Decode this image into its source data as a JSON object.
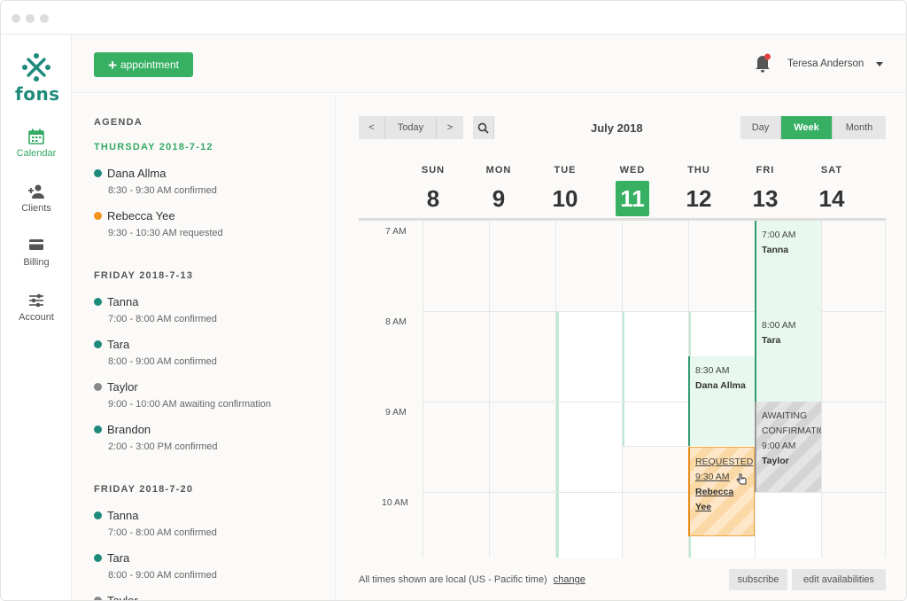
{
  "brand": {
    "name": "fons",
    "accent": "#37b063",
    "teal": "#1e8a7a"
  },
  "nav": [
    {
      "label": "Calendar",
      "icon": "calendar-icon",
      "active": true
    },
    {
      "label": "Clients",
      "icon": "clients-icon",
      "active": false
    },
    {
      "label": "Billing",
      "icon": "credit-card-icon",
      "active": false
    },
    {
      "label": "Account",
      "icon": "sliders-icon",
      "active": false
    }
  ],
  "topbar": {
    "add_label": "appointment",
    "user_name": "Teresa Anderson",
    "notification_dot_color": "#e04040"
  },
  "agenda": {
    "title": "AGENDA",
    "groups": [
      {
        "date": "THURSDAY 2018-7-12",
        "items": [
          {
            "name": "Dana Allma",
            "detail": "8:30 - 9:30 AM confirmed",
            "status_color": "#1e8a7a"
          },
          {
            "name": "Rebecca Yee",
            "detail": "9:30 - 10:30 AM requested",
            "status_color": "#f0941c"
          }
        ]
      },
      {
        "date": "FRIDAY 2018-7-13",
        "items": [
          {
            "name": "Tanna",
            "detail": "7:00 - 8:00 AM confirmed",
            "status_color": "#1e8a7a"
          },
          {
            "name": "Tara",
            "detail": "8:00 - 9:00 AM confirmed",
            "status_color": "#1e8a7a"
          },
          {
            "name": "Taylor",
            "detail": "9:00 - 10:00 AM awaiting confirmation",
            "status_color": "#888888"
          },
          {
            "name": "Brandon",
            "detail": "2:00 - 3:00 PM confirmed",
            "status_color": "#1e8a7a"
          }
        ]
      },
      {
        "date": "FRIDAY 2018-7-20",
        "items": [
          {
            "name": "Tanna",
            "detail": "7:00 - 8:00 AM confirmed",
            "status_color": "#1e8a7a"
          },
          {
            "name": "Tara",
            "detail": "8:00 - 9:00 AM confirmed",
            "status_color": "#1e8a7a"
          },
          {
            "name": "Taylor",
            "detail": "",
            "status_color": "#888888"
          }
        ]
      }
    ]
  },
  "calendar": {
    "prev_label": "<",
    "today_label": "Today",
    "next_label": ">",
    "month_label": "July 2018",
    "views": [
      "Day",
      "Week",
      "Month"
    ],
    "active_view": "Week",
    "days": [
      {
        "dow": "SUN",
        "num": "8",
        "today": false
      },
      {
        "dow": "MON",
        "num": "9",
        "today": false
      },
      {
        "dow": "TUE",
        "num": "10",
        "today": false
      },
      {
        "dow": "WED",
        "num": "11",
        "today": true
      },
      {
        "dow": "THU",
        "num": "12",
        "today": false
      },
      {
        "dow": "FRI",
        "num": "13",
        "today": false
      },
      {
        "dow": "SAT",
        "num": "14",
        "today": false
      }
    ],
    "hours": [
      "7 AM",
      "8 AM",
      "9 AM",
      "10 AM"
    ],
    "events": {
      "dana": {
        "status": "confirmed",
        "time": "8:30 AM",
        "name": "Dana Allma"
      },
      "rebecca": {
        "status": "requested",
        "label": "REQUESTED",
        "time": "9:30 AM",
        "name": "Rebecca Yee"
      },
      "tanna": {
        "status": "confirmed",
        "time": "7:00 AM",
        "name": "Tanna"
      },
      "tara": {
        "status": "confirmed",
        "time": "8:00 AM",
        "name": "Tara"
      },
      "taylor": {
        "status": "awaiting",
        "label": "AWAITING CONFIRMATION",
        "time": "9:00 AM",
        "name": "Taylor"
      }
    },
    "footer_note": "All times shown are local (US - Pacific time)",
    "change_label": "change",
    "subscribe_label": "subscribe",
    "edit_label": "edit availabilities"
  }
}
